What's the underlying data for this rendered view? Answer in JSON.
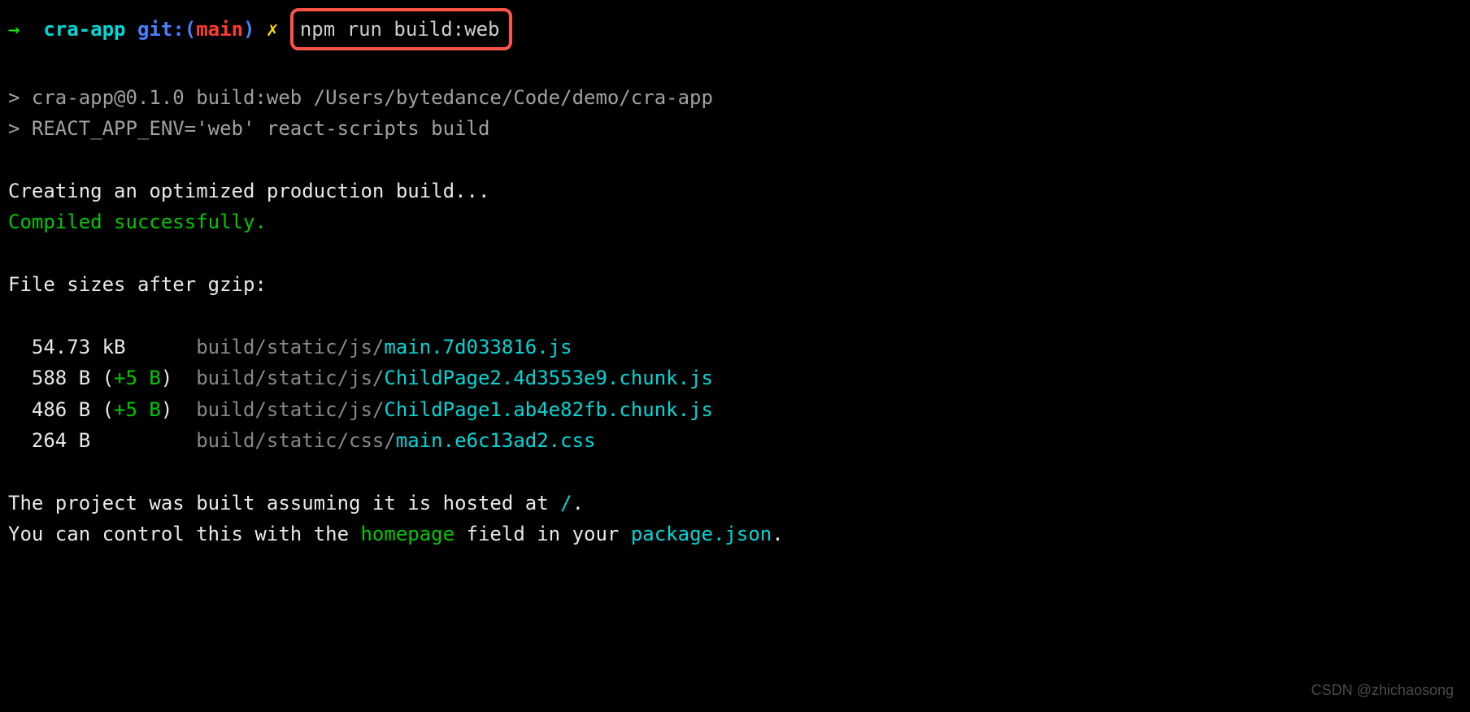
{
  "prompt": {
    "arrow": "→",
    "directory": "cra-app",
    "git_label": "git:(",
    "branch": "main",
    "git_close": ")",
    "dirty_marker": "✗",
    "command": "npm run build:web"
  },
  "output": {
    "script_header1": "> cra-app@0.1.0 build:web /Users/bytedance/Code/demo/cra-app",
    "script_header2": "> REACT_APP_ENV='web' react-scripts build",
    "creating": "Creating an optimized production build...",
    "compiled": "Compiled successfully.",
    "file_sizes_header": "File sizes after gzip:",
    "files": [
      {
        "size": "  54.73 kB      ",
        "delta": "",
        "path_prefix": "build/static/js/",
        "filename": "main.7d033816.js"
      },
      {
        "size": "  588 B ",
        "delta_open": "(",
        "delta": "+5 B",
        "delta_close": ")  ",
        "path_prefix": "build/static/js/",
        "filename": "ChildPage2.4d3553e9.chunk.js"
      },
      {
        "size": "  486 B ",
        "delta_open": "(",
        "delta": "+5 B",
        "delta_close": ")  ",
        "path_prefix": "build/static/js/",
        "filename": "ChildPage1.ab4e82fb.chunk.js"
      },
      {
        "size": "  264 B         ",
        "delta": "",
        "path_prefix": "build/static/css/",
        "filename": "main.e6c13ad2.css"
      }
    ],
    "footer_line1_a": "The project was built assuming it is hosted at ",
    "footer_line1_b": "/",
    "footer_line1_c": ".",
    "footer_line2_a": "You can control this with the ",
    "footer_line2_b": "homepage",
    "footer_line2_c": " field in your ",
    "footer_line2_d": "package.json",
    "footer_line2_e": "."
  },
  "watermark": "CSDN @zhichaosong"
}
